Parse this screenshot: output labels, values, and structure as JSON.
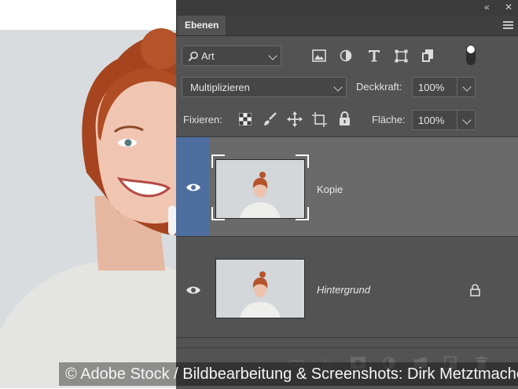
{
  "panel": {
    "tab_label": "Ebenen",
    "collapse_symbol": "«",
    "close_symbol": "✕",
    "filter_kind": "Art",
    "blend_mode": "Multiplizieren",
    "opacity_label": "Deckkraft:",
    "opacity_value": "100%",
    "lock_label": "Fixieren:",
    "fill_label": "Fläche:",
    "fill_value": "100%",
    "filter_icons": [
      "image-filter-icon",
      "adjustment-filter-icon",
      "type-filter-icon",
      "shape-filter-icon",
      "smart-object-filter-icon",
      "filter-toggle-icon"
    ],
    "lock_icons": [
      "lock-transparent-pixels-icon",
      "lock-image-pixels-icon",
      "lock-position-icon",
      "lock-artboard-icon",
      "lock-all-icon"
    ]
  },
  "layers": [
    {
      "name": "Kopie",
      "selected": true,
      "visible": true,
      "locked": false
    },
    {
      "name": "Hintergrund",
      "selected": false,
      "visible": true,
      "locked": true
    }
  ],
  "bottom_icons": [
    "link-layers-icon",
    "fx-icon",
    "add-mask-icon",
    "new-adjustment-icon",
    "new-group-icon",
    "new-layer-icon",
    "delete-layer-icon"
  ],
  "fx_text": "fx",
  "credit": "© Adobe Stock / Bildbearbeitung & Screenshots: Dirk Metztmacher",
  "colors": {
    "panel_bg": "#535353",
    "selected_eye_bg": "#4d6e9f",
    "selected_row_bg": "#6a6a6a",
    "hair": "#b5532a"
  }
}
